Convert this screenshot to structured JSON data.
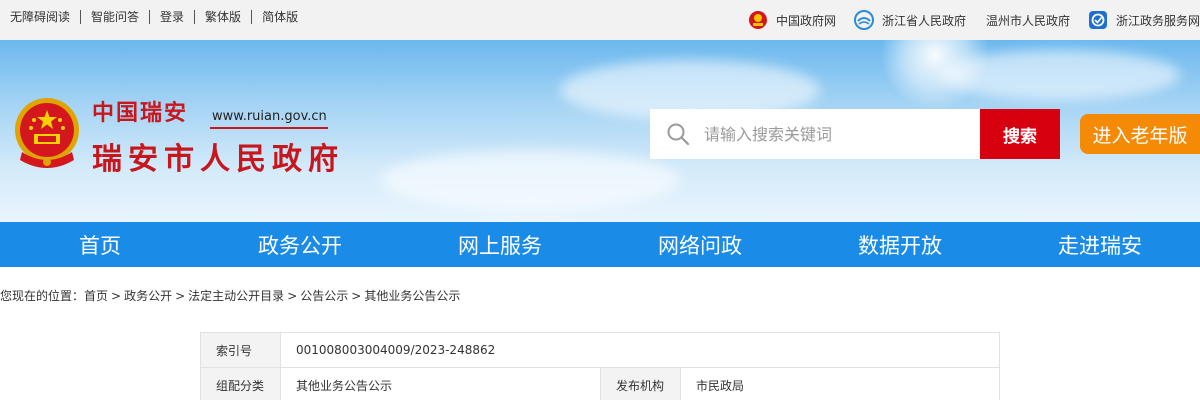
{
  "topbar": {
    "links": [
      "无障碍阅读",
      "智能问答",
      "登录",
      "繁体版",
      "简体版"
    ],
    "gov_links": [
      "中国政府网",
      "浙江省人民政府",
      "温州市人民政府",
      "浙江政务服务网"
    ]
  },
  "header": {
    "site_name": "中国瑞安",
    "domain": "www.ruian.gov.cn",
    "site_title": "瑞安市人民政府",
    "search_placeholder": "请输入搜索关键词",
    "search_label": "搜索",
    "elder_label": "进入老年版"
  },
  "nav": [
    "首页",
    "政务公开",
    "网上服务",
    "网络问政",
    "数据开放",
    "走进瑞安"
  ],
  "breadcrumb": {
    "prefix": "您现在的位置：",
    "items": [
      "首页",
      "政务公开",
      "法定主动公开目录",
      "公告公示",
      "其他业务公告公示"
    ],
    "separator": ">"
  },
  "info": {
    "index_label": "索引号",
    "index_value": "001008003004009/2023-248862",
    "category_label": "组配分类",
    "category_value": "其他业务公告公示",
    "publisher_label": "发布机构",
    "publisher_value": "市民政局"
  },
  "colors": {
    "nav_blue": "#1a8be6",
    "search_red": "#d7000f",
    "elder_orange": "#f58a07",
    "title_red": "#c8161d"
  }
}
